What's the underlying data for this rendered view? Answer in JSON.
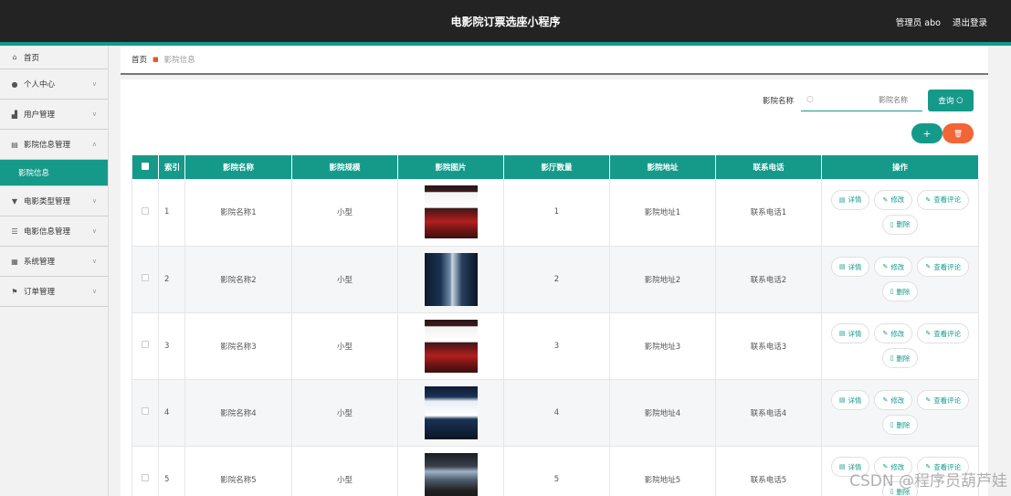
{
  "app": {
    "title": "电影院订票选座小程序"
  },
  "header": {
    "user_label": "管理员 abo",
    "logout_label": "退出登录"
  },
  "sidebar": {
    "home": {
      "label": "首页",
      "icon": "home-icon"
    },
    "items": [
      {
        "label": "个人中心",
        "icon": "user-icon",
        "expanded": false
      },
      {
        "label": "用户管理",
        "icon": "users-icon",
        "expanded": false
      },
      {
        "label": "影院信息管理",
        "icon": "document-icon",
        "expanded": true,
        "sub": [
          {
            "label": "影院信息",
            "active": true
          }
        ]
      },
      {
        "label": "电影类型管理",
        "icon": "tag-icon",
        "expanded": false
      },
      {
        "label": "电影信息管理",
        "icon": "sliders-icon",
        "expanded": false
      },
      {
        "label": "系统管理",
        "icon": "settings-icon",
        "expanded": false
      },
      {
        "label": "订单管理",
        "icon": "flag-icon",
        "expanded": false
      }
    ]
  },
  "breadcrumb": {
    "home": "首页",
    "current": "影院信息"
  },
  "search": {
    "label": "影院名称",
    "placeholder": "影院名称",
    "button_label": "查询"
  },
  "actions": {
    "add_symbol": "+",
    "delete_symbol": "🗑"
  },
  "table": {
    "columns": [
      "索引",
      "影院名称",
      "影院规模",
      "影院图片",
      "影厅数量",
      "影院地址",
      "联系电话",
      "操作"
    ],
    "row_ops": [
      "详情",
      "修改",
      "查看评论",
      "删除"
    ],
    "rows": [
      {
        "index": "1",
        "name": "影院名称1",
        "scale": "小型",
        "image": "cinema-red-seats",
        "halls": "1",
        "address": "影院地址1",
        "phone": "联系电话1"
      },
      {
        "index": "2",
        "name": "影院名称2",
        "scale": "小型",
        "image": "cinema-blue-hall",
        "halls": "2",
        "address": "影院地址2",
        "phone": "联系电话2"
      },
      {
        "index": "3",
        "name": "影院名称3",
        "scale": "小型",
        "image": "cinema-red-seats",
        "halls": "3",
        "address": "影院地址3",
        "phone": "联系电话3"
      },
      {
        "index": "4",
        "name": "影院名称4",
        "scale": "小型",
        "image": "cinema-blue-screen",
        "halls": "4",
        "address": "影院地址4",
        "phone": "联系电话4"
      },
      {
        "index": "5",
        "name": "影院名称5",
        "scale": "小型",
        "image": "cinema-audience",
        "halls": "5",
        "address": "影院地址5",
        "phone": "联系电话5"
      }
    ]
  },
  "watermark": "CSDN @程序员葫芦娃",
  "colors": {
    "accent": "#159a8a",
    "danger": "#f26536",
    "header_bg": "#232323"
  }
}
